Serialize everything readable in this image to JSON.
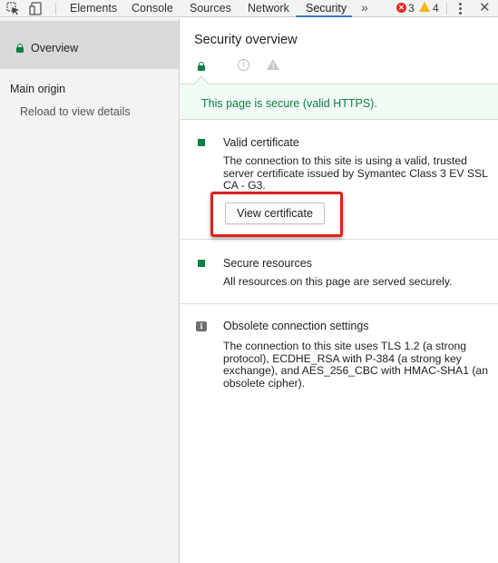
{
  "toolbar": {
    "tabs": [
      {
        "label": "Elements"
      },
      {
        "label": "Console"
      },
      {
        "label": "Sources"
      },
      {
        "label": "Network"
      },
      {
        "label": "Security"
      }
    ],
    "more_tabs": "»",
    "error_count": "3",
    "warning_count": "4",
    "error_icon": "✕",
    "close_icon": "✕",
    "active_tab": "Security",
    "accent_color": "#3879d9"
  },
  "sidebar": {
    "overview_label": "Overview",
    "main_origin_label": "Main origin",
    "reload_label": "Reload to view details"
  },
  "main": {
    "title": "Security overview",
    "banner_text": "This page is secure (valid HTTPS).",
    "sections": [
      {
        "title": "Valid certificate",
        "description": "The connection to this site is using a valid, trusted server certificate issued by Symantec Class 3 EV SSL CA - G3.",
        "button_label": "View certificate",
        "status": "secure"
      },
      {
        "title": "Secure resources",
        "description": "All resources on this page are served securely.",
        "status": "secure"
      },
      {
        "title": "Obsolete connection settings",
        "description": "The connection to this site uses TLS 1.2 (a strong protocol), ECDHE_RSA with P-384 (a strong key exchange), and AES_256_CBC with HMAC-SHA1 (an obsolete cipher).",
        "status": "info"
      }
    ]
  },
  "colors": {
    "secure_green": "#0b8043",
    "highlight_red": "#e0201c"
  }
}
